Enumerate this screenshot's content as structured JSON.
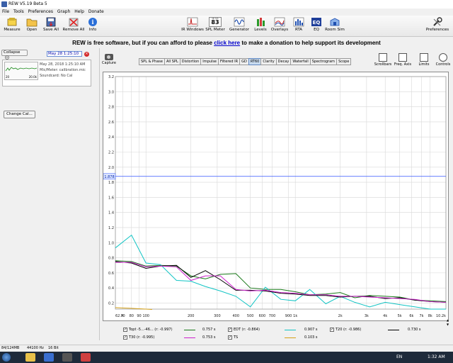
{
  "window": {
    "title": "REW V5.19 Beta 5"
  },
  "menu": [
    "File",
    "Tools",
    "Preferences",
    "Graph",
    "Help",
    "Donate"
  ],
  "toolbar": {
    "left": [
      {
        "label": "Measure",
        "icon": "measure-icon"
      },
      {
        "label": "Open",
        "icon": "folder-open-icon"
      },
      {
        "label": "Save All",
        "icon": "save-icon"
      },
      {
        "label": "Remove All",
        "icon": "remove-all-icon"
      },
      {
        "label": "Info",
        "icon": "info-icon"
      }
    ],
    "center": [
      {
        "label": "IR Windows",
        "icon": "ir-windows-icon"
      },
      {
        "label": "SPL Meter",
        "icon": "spl-meter-icon",
        "readout": "83",
        "readout_unit": "dB SPL"
      },
      {
        "label": "Generator",
        "icon": "generator-icon"
      },
      {
        "label": "Levels",
        "icon": "levels-icon"
      },
      {
        "label": "Overlays",
        "icon": "overlays-icon"
      },
      {
        "label": "RTA",
        "icon": "rta-icon"
      },
      {
        "label": "EQ",
        "icon": "eq-icon"
      },
      {
        "label": "Room Sim",
        "icon": "room-sim-icon"
      }
    ],
    "right": [
      {
        "label": "Preferences",
        "icon": "preferences-icon"
      }
    ]
  },
  "banner": {
    "before": "REW is free software, but if you can afford to please ",
    "link": "click here",
    "after": " to make a donation to help support its development"
  },
  "left_panel": {
    "collapse_label": "Collapse",
    "measurement_name": "May 28 1:25:10",
    "thumb_x_start": "20",
    "thumb_x_end": "20.0k",
    "info_lines": [
      "May 28, 2018 1:25:10 AM",
      "Mic/Meter: calibration.mic",
      "Soundcard: No Cal"
    ],
    "change_cal_label": "Change Cal..."
  },
  "capture_label": "Capture",
  "tabs": [
    {
      "label": "SPL & Phase",
      "active": false
    },
    {
      "label": "All SPL",
      "active": false
    },
    {
      "label": "Distortion",
      "active": false
    },
    {
      "label": "Impulse",
      "active": false
    },
    {
      "label": "Filtered IR",
      "active": false
    },
    {
      "label": "GD",
      "active": false
    },
    {
      "label": "RT60",
      "active": true
    },
    {
      "label": "Clarity",
      "active": false
    },
    {
      "label": "Decay",
      "active": false
    },
    {
      "label": "Waterfall",
      "active": false
    },
    {
      "label": "Spectrogram",
      "active": false
    },
    {
      "label": "Scope",
      "active": false
    }
  ],
  "right_tools": [
    {
      "label": "Scrollbars",
      "icon": "scrollbars-icon"
    },
    {
      "label": "Freq. Axis",
      "icon": "freq-axis-icon"
    },
    {
      "label": "Limits",
      "icon": "limits-icon"
    },
    {
      "label": "Controls",
      "icon": "controls-icon"
    }
  ],
  "chart_data": {
    "type": "line",
    "x_scale": "log",
    "xlim": [
      62.4,
      10200
    ],
    "ylim": [
      0.12,
      3.2
    ],
    "x_ticks": [
      {
        "v": 62.4,
        "label": "62.4"
      },
      {
        "v": 70,
        "label": "70"
      },
      {
        "v": 80,
        "label": "80"
      },
      {
        "v": 90,
        "label": "90"
      },
      {
        "v": 100,
        "label": "100"
      },
      {
        "v": 200,
        "label": "200"
      },
      {
        "v": 300,
        "label": "300"
      },
      {
        "v": 400,
        "label": "400"
      },
      {
        "v": 500,
        "label": "500"
      },
      {
        "v": 600,
        "label": "600"
      },
      {
        "v": 700,
        "label": "700"
      },
      {
        "v": 900,
        "label": "900"
      },
      {
        "v": 1000,
        "label": "1k"
      },
      {
        "v": 2000,
        "label": "2k"
      },
      {
        "v": 3000,
        "label": "3k"
      },
      {
        "v": 4000,
        "label": "4k"
      },
      {
        "v": 5000,
        "label": "5k"
      },
      {
        "v": 6000,
        "label": "6k"
      },
      {
        "v": 7000,
        "label": "7k"
      },
      {
        "v": 8000,
        "label": "8k"
      },
      {
        "v": 10200,
        "label": "10.2k"
      }
    ],
    "y_ticks": [
      3.2,
      3.0,
      2.8,
      2.6,
      2.4,
      2.2,
      2.0,
      1.8,
      1.6,
      1.4,
      1.2,
      1.0,
      0.8,
      0.6,
      0.4,
      0.2
    ],
    "cursor_y": {
      "value": 1.878,
      "label": "1.878",
      "color": "#3355ff"
    },
    "grid": true,
    "series": [
      {
        "name": "Topt -5...-46...",
        "fit": "(r: -0.997)",
        "value": "0.757 s",
        "color": "#1a7a1a",
        "x": [
          62.4,
          80,
          100,
          125,
          160,
          200,
          250,
          315,
          400,
          500,
          630,
          800,
          1000,
          1250,
          1600,
          2000,
          2500,
          3150,
          4000,
          5000,
          6300,
          8000,
          10200
        ],
        "y": [
          0.76,
          0.75,
          0.69,
          0.7,
          0.69,
          0.56,
          0.52,
          0.58,
          0.59,
          0.4,
          0.38,
          0.38,
          0.35,
          0.31,
          0.32,
          0.34,
          0.27,
          0.3,
          0.29,
          0.28,
          0.24,
          0.23,
          0.22
        ]
      },
      {
        "name": "EDT",
        "fit": "(r: -0.864)",
        "value": "0.907 s",
        "color": "#11c4c4",
        "x": [
          62.4,
          80,
          100,
          125,
          160,
          200,
          250,
          315,
          400,
          500,
          630,
          800,
          1000,
          1250,
          1600,
          2000,
          2500,
          3150,
          4000,
          5000,
          6300,
          8000,
          10200
        ],
        "y": [
          0.93,
          1.1,
          0.73,
          0.71,
          0.5,
          0.49,
          0.42,
          0.36,
          0.29,
          0.15,
          0.41,
          0.25,
          0.23,
          0.38,
          0.19,
          0.29,
          0.21,
          0.15,
          0.21,
          0.18,
          0.15,
          0.12,
          0.12
        ]
      },
      {
        "name": "T20",
        "fit": "(r: -0.986)",
        "value": "0.730 s",
        "color": "#000000",
        "x": [
          62.4,
          80,
          100,
          125,
          160,
          200,
          250,
          315,
          400,
          500,
          630,
          800,
          1000,
          1250,
          1600,
          2000,
          2500,
          3150,
          4000,
          5000,
          6300,
          8000,
          10200
        ],
        "y": [
          0.75,
          0.73,
          0.66,
          0.69,
          0.7,
          0.54,
          0.63,
          0.51,
          0.37,
          0.37,
          0.36,
          0.33,
          0.32,
          0.3,
          0.3,
          0.28,
          0.29,
          0.29,
          0.26,
          0.27,
          0.24,
          0.22,
          0.21
        ]
      },
      {
        "name": "T30",
        "fit": "(r: -0.995)",
        "value": "0.753 s",
        "color": "#cc22cc",
        "x": [
          62.4,
          80,
          100,
          125,
          160,
          200,
          250,
          315,
          400,
          500,
          630,
          800,
          1000,
          1250,
          1600,
          2000,
          2500,
          3150,
          4000,
          5000,
          6300,
          8000,
          10200
        ],
        "y": [
          0.74,
          0.74,
          0.68,
          0.69,
          0.68,
          0.5,
          0.56,
          0.56,
          0.38,
          0.36,
          0.37,
          0.34,
          0.33,
          0.31,
          0.31,
          0.29,
          0.29,
          0.28,
          0.27,
          0.26,
          0.25,
          0.22,
          0.21
        ]
      },
      {
        "name": "TS",
        "fit": "",
        "value": "0.103 s",
        "color": "#d4a017",
        "x": [
          62.4,
          70,
          80,
          90,
          100,
          110
        ],
        "y": [
          0.14,
          0.135,
          0.13,
          0.125,
          0.12,
          0.115
        ]
      }
    ]
  },
  "legend_checks": [
    {
      "key": "Topt -5...-46... (r: -0.997)",
      "checked": true
    },
    {
      "key": "EDT (r: -0.864)",
      "checked": true
    },
    {
      "key": "T20 (r: -0.986)",
      "checked": true
    },
    {
      "key": "T30 (r: -0.995)",
      "checked": true
    },
    {
      "key": "TS",
      "checked": true
    }
  ],
  "status": {
    "memory": "84/124MB",
    "rate": "44100 Hz",
    "bits": "16 Bit"
  },
  "taskbar": {
    "lang": "EN",
    "time": "1:32 AM"
  }
}
